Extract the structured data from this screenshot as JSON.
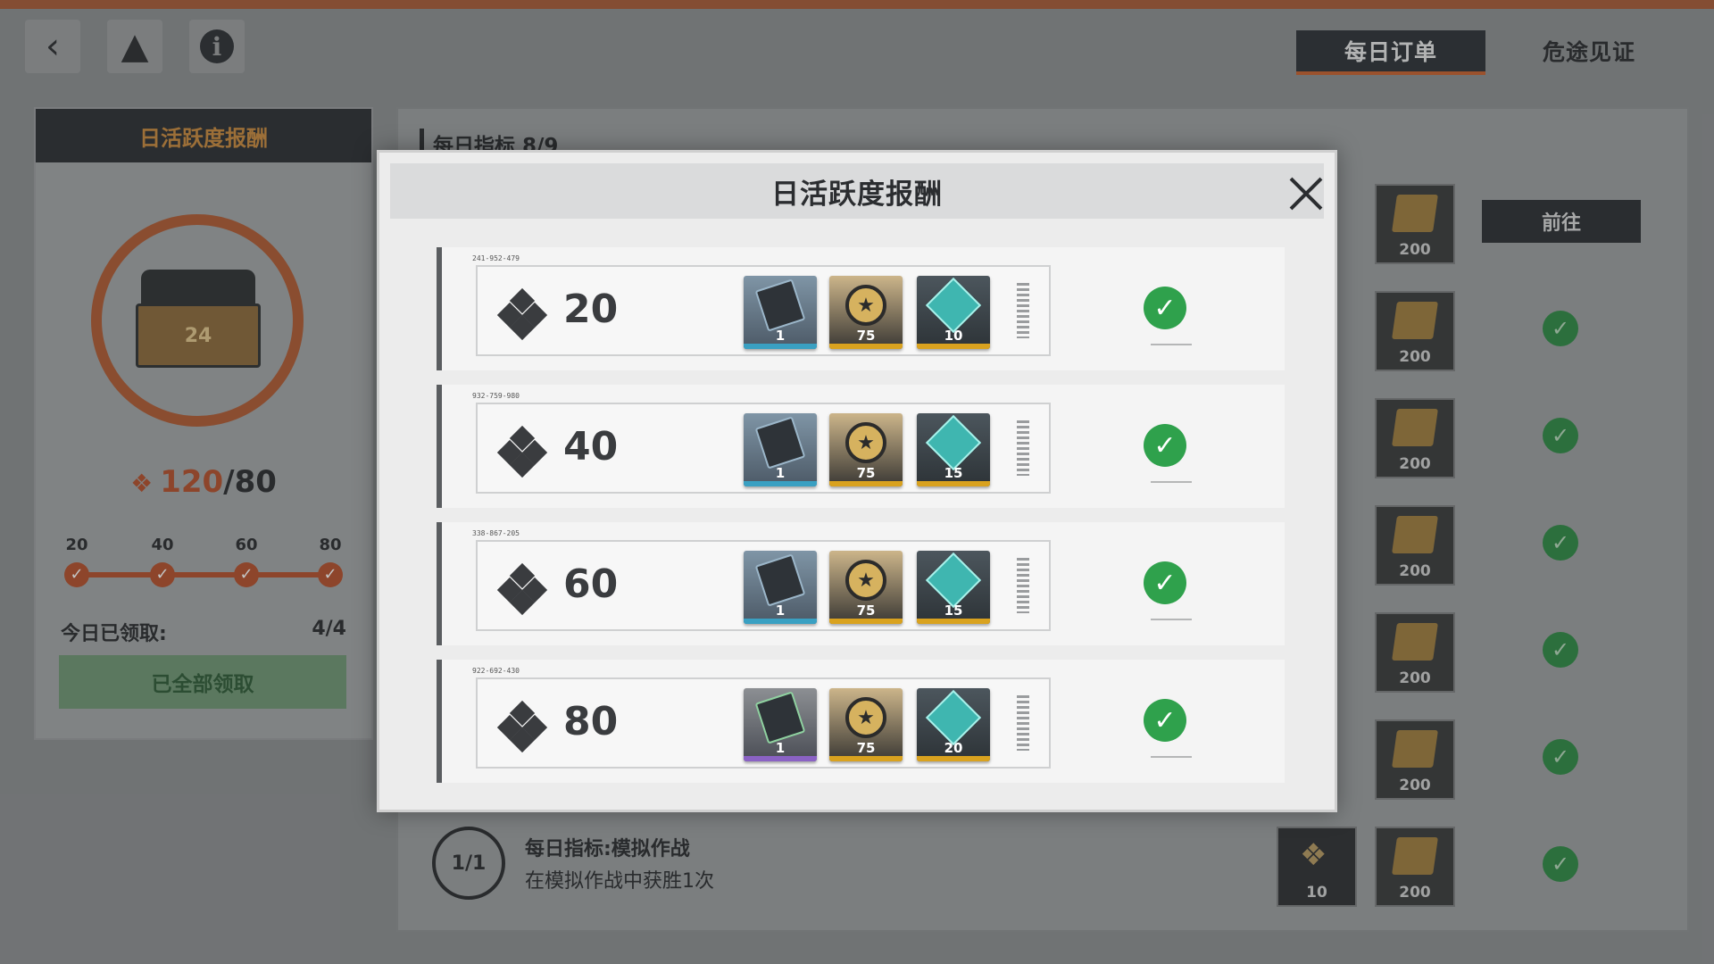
{
  "top_tabs": {
    "daily_order": "每日订单",
    "perilous_witness": "危途见证"
  },
  "left_panel": {
    "title": "日活跃度报酬",
    "progress_current": "120",
    "progress_total": "/80",
    "milestones": [
      "20",
      "40",
      "60",
      "80"
    ],
    "claimed_label": "今日已领取:",
    "claimed_value": "4/4",
    "all_claimed_button": "已全部领取"
  },
  "main_panel": {
    "title": "每日指标 8/9",
    "goto_button": "前往",
    "reward_qty": "200",
    "last_task": {
      "progress": "1/1",
      "title": "每日指标:模拟作战",
      "description": "在模拟作战中获胜1次",
      "activity_qty": "10",
      "reward_qty": "200"
    }
  },
  "modal": {
    "title": "日活跃度报酬",
    "rows": [
      {
        "code": "241-952-479",
        "value": "20",
        "items": [
          "1",
          "75",
          "10"
        ]
      },
      {
        "code": "932-759-980",
        "value": "40",
        "items": [
          "1",
          "75",
          "15"
        ]
      },
      {
        "code": "338-867-205",
        "value": "60",
        "items": [
          "1",
          "75",
          "15"
        ]
      },
      {
        "code": "922-692-430",
        "value": "80",
        "items": [
          "1",
          "75",
          "20"
        ]
      }
    ]
  },
  "colors": {
    "accent_orange": "#b4502b",
    "check_green": "#2fa14c",
    "header_dark": "#2b2f33"
  }
}
